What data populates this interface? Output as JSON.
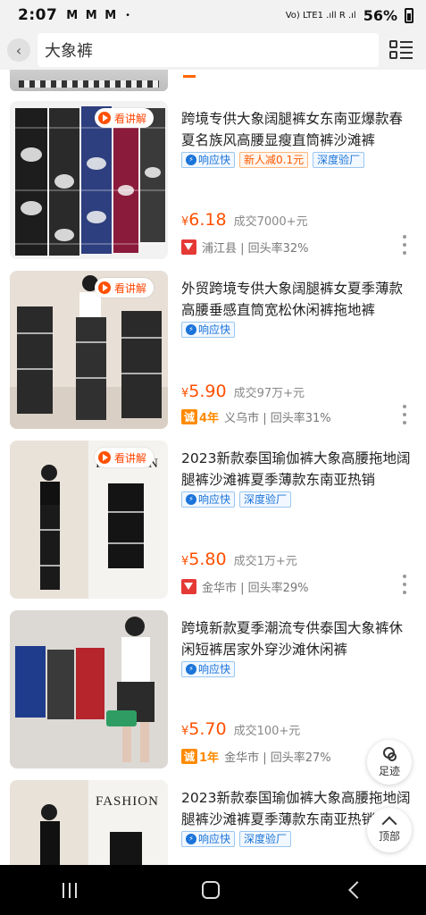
{
  "status_bar": {
    "time": "2:07",
    "notifications": "M M M",
    "dot": "•",
    "signal": "Vo) LTE1 .ıll R .ıl",
    "battery": "56%"
  },
  "search": {
    "query": "大象裤"
  },
  "products": [
    {
      "title": "跨境专供大象阔腿裤女东南亚爆款春夏名族风高腰显瘦直筒裤沙滩裤",
      "badge": "看讲解",
      "tags": [
        {
          "text": "响应快",
          "style": "blue",
          "icon": "bolt-icon"
        },
        {
          "text": "新人减0.1元",
          "style": "orange"
        },
        {
          "text": "深度验厂",
          "style": "blue"
        }
      ],
      "price_symbol": "¥",
      "price": "6.18",
      "sales": "成交7000+元",
      "shop_icon": "shop-icon",
      "location_info": "浦江县 | 回头率32%",
      "image_palette": [
        "#1d1d1d",
        "#f4f4f4",
        "#2e3f7f",
        "#8b1b3b"
      ]
    },
    {
      "title": "外贸跨境专供大象阔腿裤女夏季薄款高腰垂感直筒宽松休闲裤拖地裤",
      "badge": "看讲解",
      "tags": [
        {
          "text": "响应快",
          "style": "blue",
          "icon": "bolt-icon"
        }
      ],
      "price_symbol": "¥",
      "price": "5.90",
      "sales": "成交97万+元",
      "cheng_badge": "诚",
      "years": "4年",
      "location_info": "义乌市 | 回头率31%",
      "image_palette": [
        "#e8dfd6",
        "#2a2a2a",
        "#c8c0b8"
      ]
    },
    {
      "title": "2023新款泰国瑜伽裤大象高腰拖地阔腿裤沙滩裤夏季薄款东南亚热销",
      "badge": "看讲解",
      "image_text": "FASHION",
      "tags": [
        {
          "text": "响应快",
          "style": "blue",
          "icon": "bolt-icon"
        },
        {
          "text": "深度验厂",
          "style": "blue"
        }
      ],
      "price_symbol": "¥",
      "price": "5.80",
      "sales": "成交1万+元",
      "shop_icon": "shop-icon",
      "location_info": "金华市 | 回头率29%",
      "image_palette": [
        "#f5f3f0",
        "#111111",
        "#e9e2d9"
      ]
    },
    {
      "title": "跨境新款夏季潮流专供泰国大象裤休闲短裤居家外穿沙滩休闲裤",
      "tags": [
        {
          "text": "响应快",
          "style": "blue",
          "icon": "bolt-icon"
        }
      ],
      "price_symbol": "¥",
      "price": "5.70",
      "sales": "成交100+元",
      "cheng_badge": "诚",
      "years": "1年",
      "location_info": "金华市 | 回头率27%",
      "image_palette": [
        "#dcd8d4",
        "#1f3b8c",
        "#3a3a3a",
        "#b6242c"
      ]
    },
    {
      "title": "2023新款泰国瑜伽裤大象高腰拖地阔腿裤沙滩裤夏季薄款东南亚热销",
      "image_text": "FASHION",
      "tags": [
        {
          "text": "响应快",
          "style": "blue",
          "icon": "bolt-icon"
        },
        {
          "text": "深度验厂",
          "style": "blue"
        }
      ],
      "image_palette": [
        "#f5f3f0",
        "#111111"
      ]
    }
  ],
  "floating": {
    "footprint_label": "足迹",
    "top_label": "顶部"
  },
  "colors": {
    "accent": "#ff5000",
    "tag_blue": "#1a73d9",
    "background": "#ffffff"
  }
}
